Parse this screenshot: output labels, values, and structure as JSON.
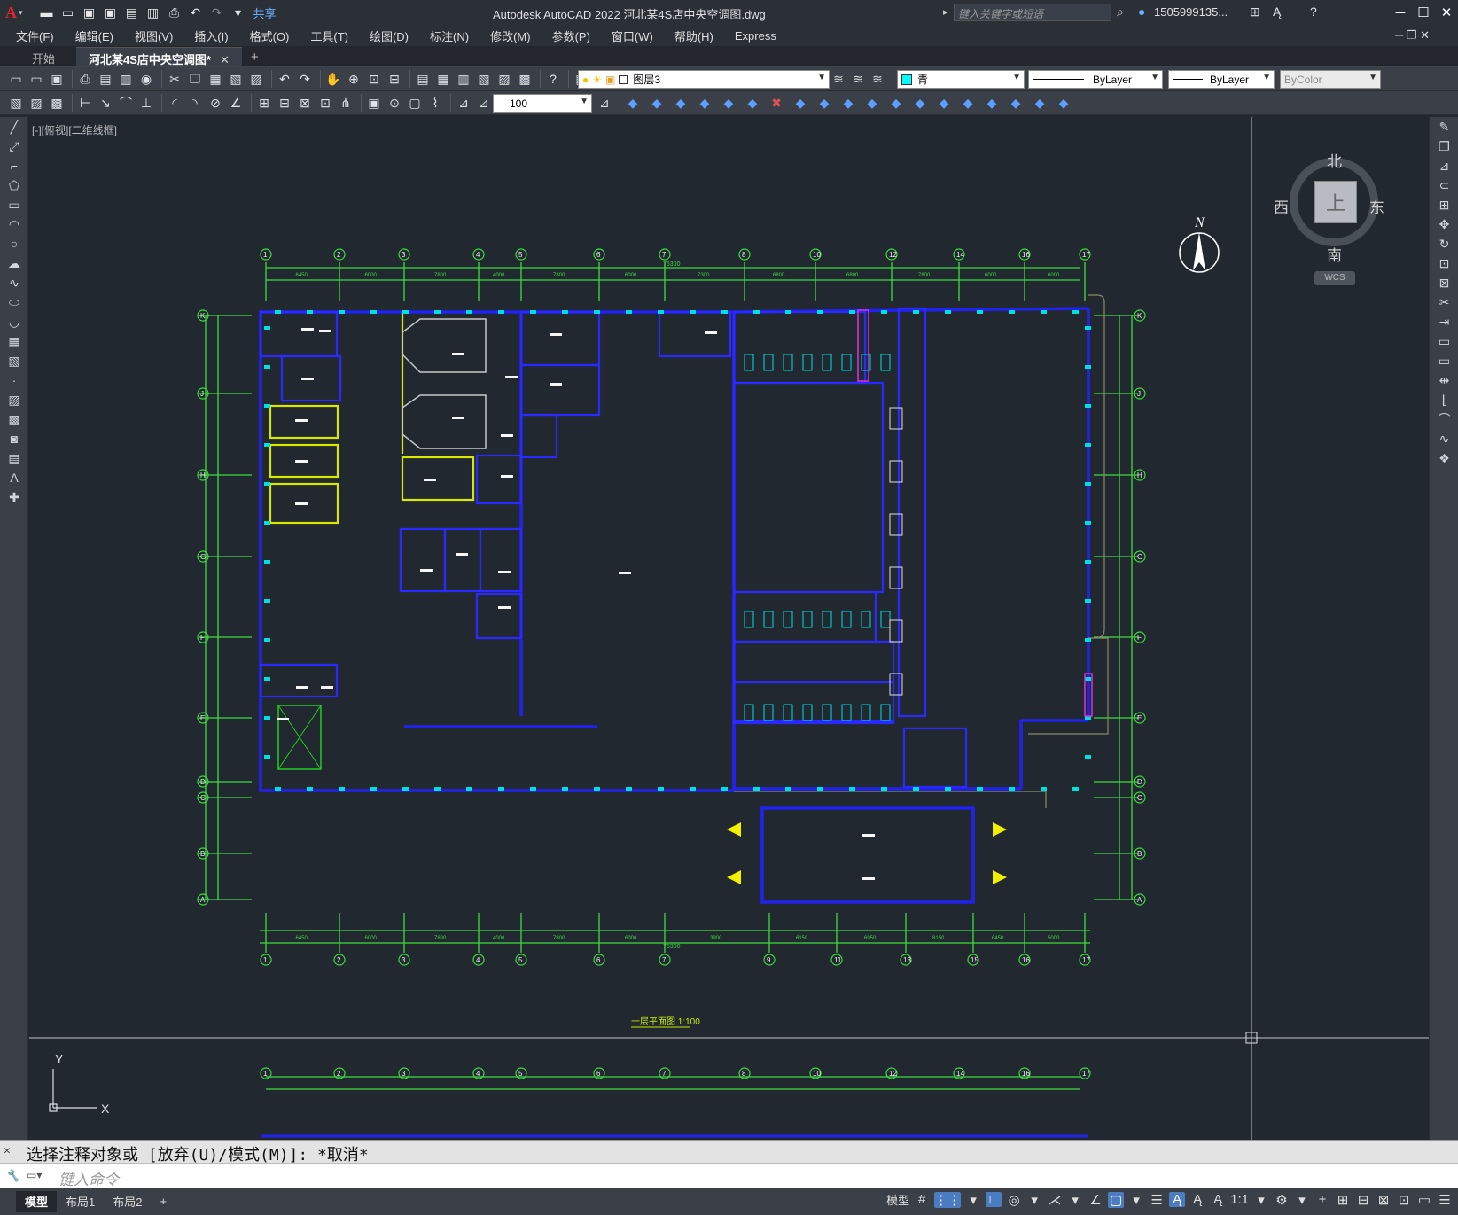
{
  "app": {
    "title": "Autodesk AutoCAD 2022    河北某4S店中央空调图.dwg",
    "share": "共享",
    "search_placeholder": "键入关键字或短语",
    "user": "1505999135..."
  },
  "menu": [
    "文件(F)",
    "编辑(E)",
    "视图(V)",
    "插入(I)",
    "格式(O)",
    "工具(T)",
    "绘图(D)",
    "标注(N)",
    "修改(M)",
    "参数(P)",
    "窗口(W)",
    "帮助(H)",
    "Express"
  ],
  "tabs": {
    "start": "开始",
    "doc": "河北某4S店中央空调图*"
  },
  "toolbar": {
    "layer": "图层3",
    "color": "青",
    "linetype": "ByLayer",
    "lineweight": "ByLayer",
    "plotstyle": "ByColor",
    "scale": "100"
  },
  "viewport": {
    "label": "[-][俯视][二维线框]"
  },
  "viewcube": {
    "top": "上",
    "north": "北",
    "south": "南",
    "east": "东",
    "west": "西",
    "wcs": "WCS"
  },
  "drawing": {
    "caption": "一层平面图 1:100",
    "col_labels": [
      "1",
      "2",
      "3",
      "4",
      "5",
      "6",
      "7",
      "8",
      "10",
      "12",
      "14",
      "16",
      "17"
    ],
    "bottom_col_labels": [
      "1",
      "2",
      "3",
      "4",
      "5",
      "6",
      "7",
      "9",
      "11",
      "13",
      "15",
      "16",
      "17"
    ],
    "row_labels": [
      "K",
      "J",
      "H",
      "G",
      "F",
      "E",
      "D",
      "C",
      "B",
      "A"
    ],
    "top_dims": [
      "6450",
      "6000",
      "7800",
      "4000",
      "7800",
      "6000",
      "7300",
      "6800",
      "6800",
      "7800",
      "6000",
      "6000",
      "7800"
    ],
    "bottom_dims": [
      "6450",
      "6000",
      "7800",
      "4000",
      "7800",
      "6000",
      "3900",
      "6150",
      "6950",
      "8150",
      "6450",
      "5000",
      "350"
    ],
    "total_dim": "75300",
    "north": "N"
  },
  "command": {
    "history": "选择注释对象或 [放弃(U)/模式(M)]: *取消*",
    "placeholder": "键入命令"
  },
  "status": {
    "layouts": [
      "模型",
      "布局1",
      "布局2"
    ],
    "model": "模型",
    "scale": "1:1"
  }
}
